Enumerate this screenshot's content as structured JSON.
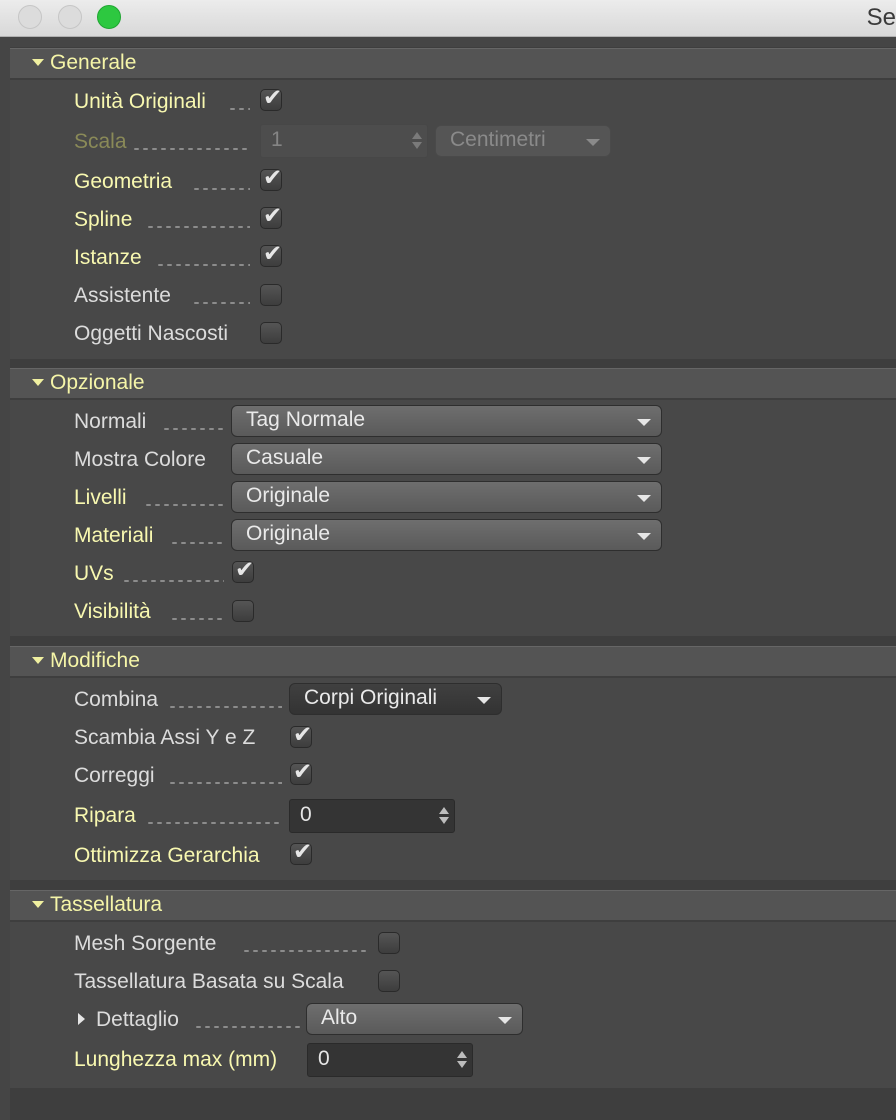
{
  "window": {
    "title": "Se"
  },
  "sections": {
    "generale": {
      "title": "Generale",
      "unita_originali": {
        "label": "Unità Originali",
        "checked": true
      },
      "scala": {
        "label": "Scala",
        "value": "1",
        "unit": "Centimetri"
      },
      "geometria": {
        "label": "Geometria",
        "checked": true
      },
      "spline": {
        "label": "Spline",
        "checked": true
      },
      "istanze": {
        "label": "Istanze",
        "checked": true
      },
      "assistente": {
        "label": "Assistente",
        "checked": false
      },
      "oggetti_nascosti": {
        "label": "Oggetti Nascosti",
        "checked": false
      }
    },
    "opzionale": {
      "title": "Opzionale",
      "normali": {
        "label": "Normali",
        "value": "Tag Normale"
      },
      "mostra_colore": {
        "label": "Mostra Colore",
        "value": "Casuale"
      },
      "livelli": {
        "label": "Livelli",
        "value": "Originale"
      },
      "materiali": {
        "label": "Materiali",
        "value": "Originale"
      },
      "uvs": {
        "label": "UVs",
        "checked": true
      },
      "visibilita": {
        "label": "Visibilità",
        "checked": false
      }
    },
    "modifiche": {
      "title": "Modifiche",
      "combina": {
        "label": "Combina",
        "value": "Corpi Originali"
      },
      "scambia_assi": {
        "label": "Scambia Assi Y e Z",
        "checked": true
      },
      "correggi": {
        "label": "Correggi",
        "checked": true
      },
      "ripara": {
        "label": "Ripara",
        "value": "0"
      },
      "ottimizza_gerarchia": {
        "label": "Ottimizza Gerarchia",
        "checked": true
      }
    },
    "tassellatura": {
      "title": "Tassellatura",
      "mesh_sorgente": {
        "label": "Mesh Sorgente",
        "checked": false
      },
      "tassellatura_scala": {
        "label": "Tassellatura Basata su Scala",
        "checked": false
      },
      "dettaglio": {
        "label": "Dettaglio",
        "value": "Alto"
      },
      "lunghezza_max": {
        "label": "Lunghezza max (mm)",
        "value": "0"
      }
    }
  },
  "glyphs": {
    "check": "✔"
  },
  "colors": {
    "label_active": "#f8f8b0",
    "label_normal": "#dcdcdc",
    "label_disabled": "#8a8a58",
    "header_bg": "#545454",
    "panel_bg": "#484848"
  }
}
